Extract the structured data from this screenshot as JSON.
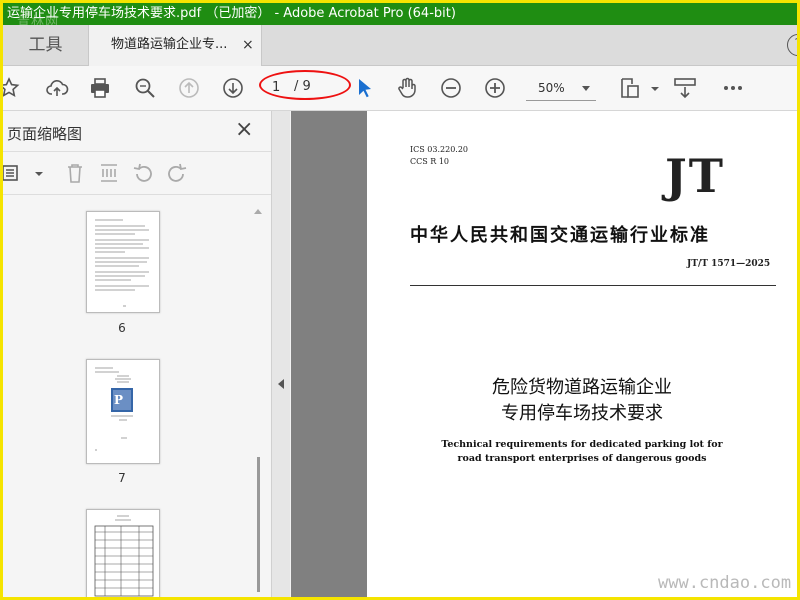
{
  "window": {
    "title": "运输企业专用停车场技术要求.pdf （已加密） - Adobe Acrobat Pro (64-bit)"
  },
  "watermark_top": "青林网",
  "tabs": {
    "tools": "工具",
    "document": "物道路运输企业专...",
    "close": "×",
    "help": "?"
  },
  "toolbar": {
    "page_current": "1",
    "page_total": "/ 9",
    "zoom": "50%"
  },
  "sidebar": {
    "title": "页面缩略图",
    "close": "×",
    "thumbnails": [
      {
        "label": "6"
      },
      {
        "label": "7"
      }
    ]
  },
  "document": {
    "ics": "ICS 03.220.20",
    "ccs": "CCS R 10",
    "logo": "JT",
    "standard_title": "中华人民共和国交通运输行业标准",
    "standard_code": "JT/T 1571—2025",
    "title_cn_line1": "危险货物道路运输企业",
    "title_cn_line2": "专用停车场技术要求",
    "title_en_line1": "Technical requirements for dedicated parking lot for",
    "title_en_line2": "road transport enterprises of dangerous goods"
  },
  "watermark_bottom": "www.cndao.com",
  "colors": {
    "titlebar": "#1f8d12",
    "border": "#f5e400",
    "highlight": "#e11111",
    "select_tool": "#1a6fd0"
  }
}
